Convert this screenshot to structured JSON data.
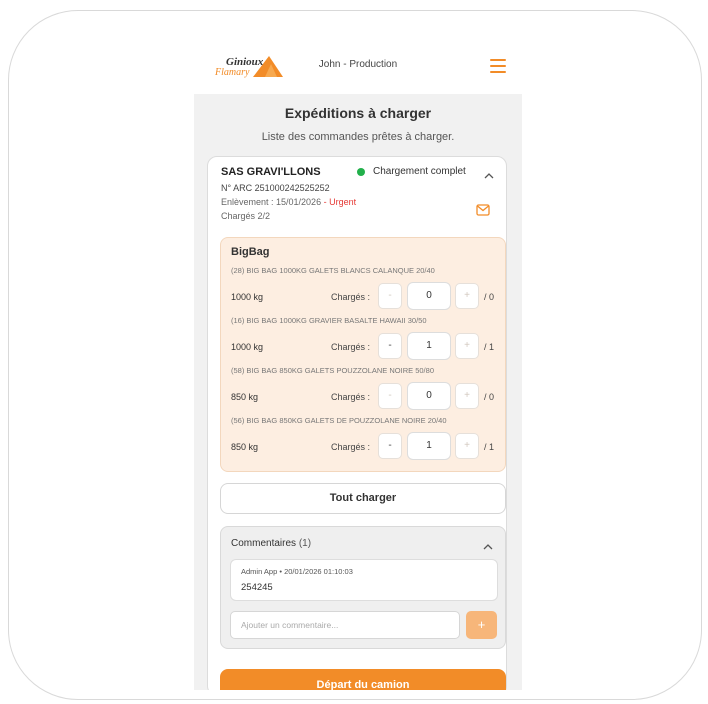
{
  "header": {
    "logo_text": "Ginioux Flamary",
    "user": "John - Production",
    "menu_icon": "hamburger-menu-icon"
  },
  "page": {
    "title": "Expéditions à charger",
    "subtitle": "Liste des commandes prêtes à charger."
  },
  "order": {
    "client": "SAS GRAVI'LLONS",
    "status": "Chargement complet",
    "status_color": "#22b04b",
    "arc": "N° ARC 251000242525252",
    "pickup": "Enlèvement : 15/01/2026",
    "urgent": "- Urgent",
    "loaded": "Chargés 2/2"
  },
  "bigbag": {
    "title": "BigBag",
    "loaded_label": "Chargés :",
    "items": [
      {
        "name": "(28) BIG BAG 1000KG GALETS BLANCS CALANQUE 20/40",
        "weight": "1000 kg",
        "minus": "-",
        "value": "0",
        "plus": "+",
        "max": "/ 0"
      },
      {
        "name": "(16) BIG BAG 1000KG GRAVIER BASALTE HAWAII 30/50",
        "weight": "1000 kg",
        "minus": "-",
        "value": "1",
        "plus": "+",
        "max": "/ 1"
      },
      {
        "name": "(58) BIG BAG 850KG GALETS POUZZOLANE NOIRE 50/80",
        "weight": "850 kg",
        "minus": "-",
        "value": "0",
        "plus": "+",
        "max": "/ 0"
      },
      {
        "name": "(56) BIG BAG 850KG GALETS DE POUZZOLANE NOIRE 20/40",
        "weight": "850 kg",
        "minus": "-",
        "value": "1",
        "plus": "+",
        "max": "/ 1"
      }
    ]
  },
  "actions": {
    "load_all": "Tout charger",
    "depart": "Départ du camion"
  },
  "comments": {
    "title": "Commentaires",
    "count": "(1)",
    "entries": [
      {
        "meta": "Admin App • 20/01/2026 01:10:03",
        "text": "254245"
      }
    ],
    "placeholder": "Ajouter un commentaire...",
    "add": "+"
  },
  "colors": {
    "accent": "#f28c28",
    "accent_light": "#f7b67a",
    "bigbag_bg": "#fdeee1",
    "urgent": "#e53935"
  }
}
